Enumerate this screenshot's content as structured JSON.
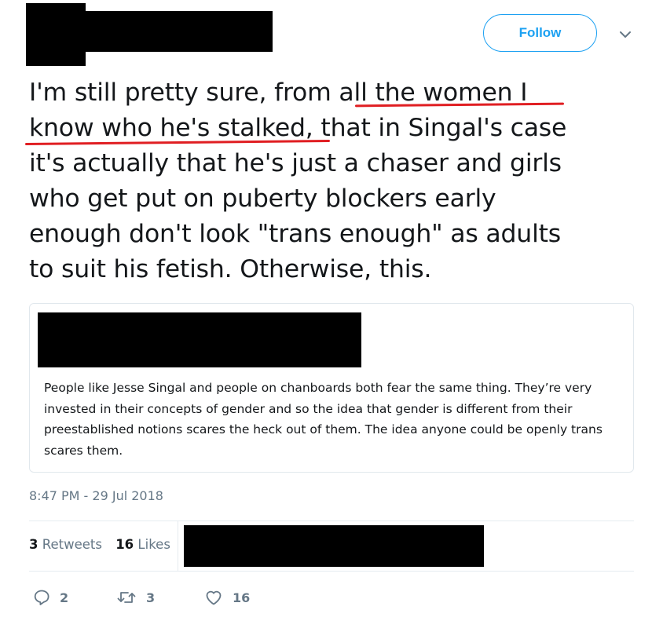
{
  "header": {
    "follow_label": "Follow",
    "caret_icon": "chevron-down-icon"
  },
  "tweet": {
    "lines": [
      "I'm still pretty sure, from all the women I",
      "know who he's stalked, that in Singal's case",
      "it's actually that he's just a chaser and girls",
      "who get put on puberty blockers early",
      "enough don't look \"trans enough\" as adults",
      "to suit his fetish. Otherwise, this."
    ]
  },
  "quote": {
    "text": "People like Jesse Singal and people on chanboards both fear the same thing. They’re very invested in their concepts of gender and so the idea that gender is different from their preestablished notions scares the heck out of them. The idea anyone could be openly trans scares them."
  },
  "meta": {
    "timestamp": "8:47 PM - 29 Jul 2018"
  },
  "stats": {
    "retweets_count": "3",
    "retweets_label": "Retweets",
    "likes_count": "16",
    "likes_label": "Likes"
  },
  "actions": {
    "reply_count": "2",
    "retweet_count": "3",
    "like_count": "16"
  },
  "colors": {
    "accent": "#1da1f2",
    "annotation_underline": "#e01e22",
    "muted_text": "#657786",
    "redaction": "#000000"
  }
}
